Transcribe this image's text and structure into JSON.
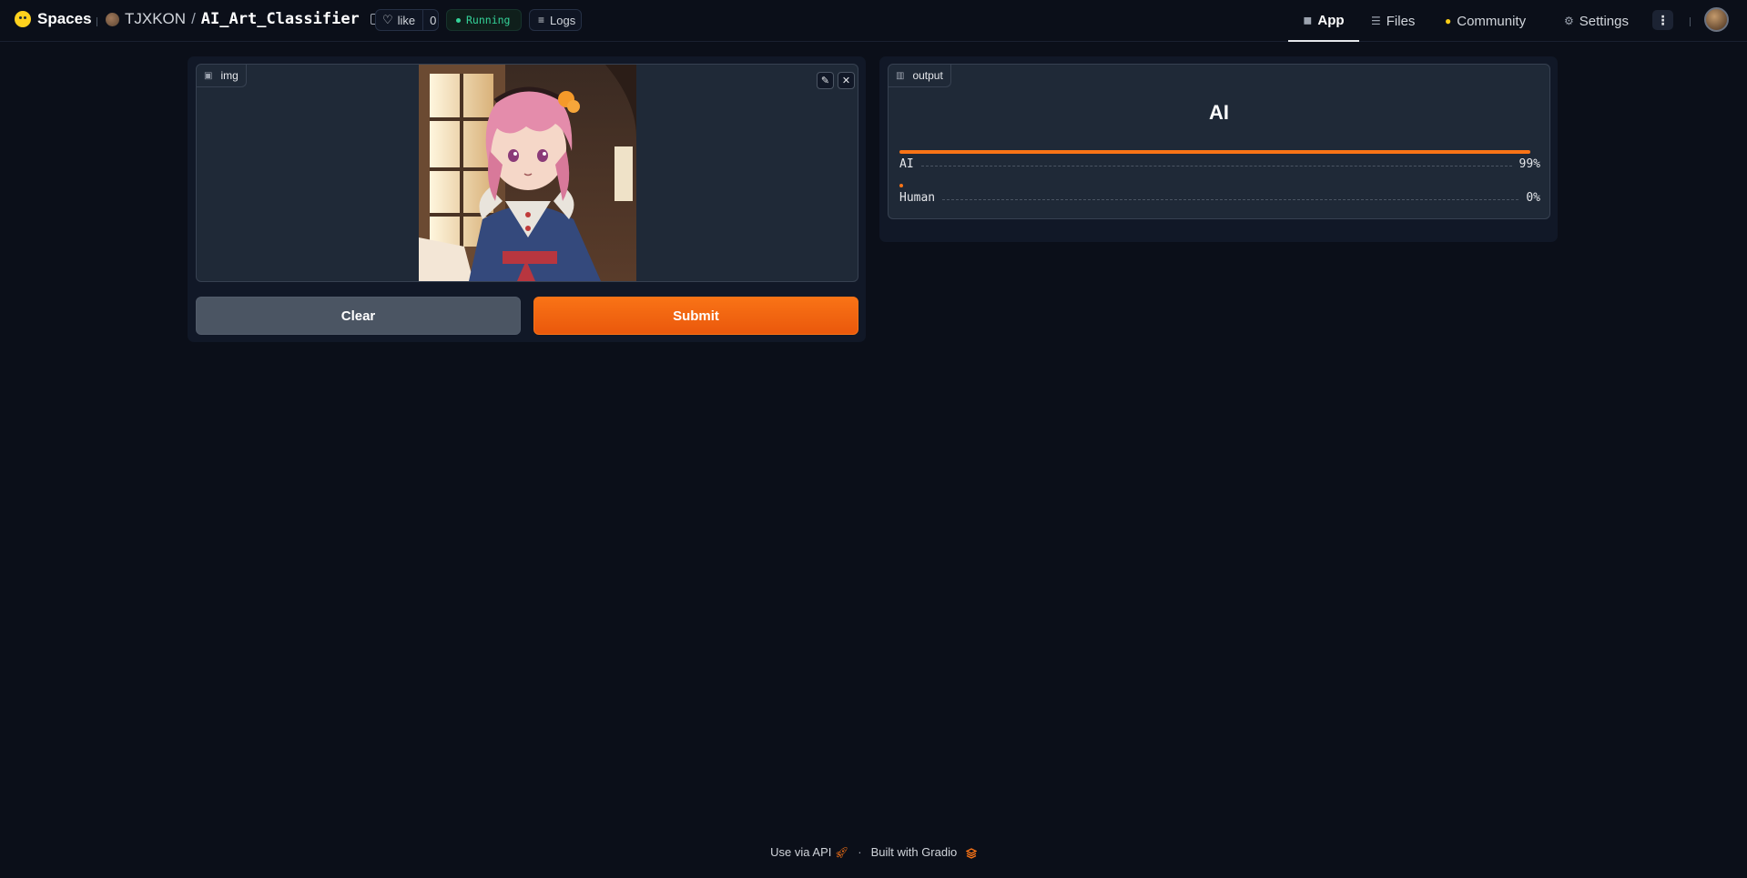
{
  "header": {
    "brand": "Spaces",
    "owner": "TJXKON",
    "repo_name": "AI_Art_Classifier",
    "like_label": "like",
    "like_count": "0",
    "status": "Running",
    "logs_label": "Logs",
    "tabs": [
      {
        "label": "App",
        "icon": "cube-icon",
        "active": true
      },
      {
        "label": "Files",
        "icon": "files-icon",
        "active": false
      },
      {
        "label": "Community",
        "icon": "community-icon",
        "active": false
      },
      {
        "label": "Settings",
        "icon": "gear-icon",
        "active": false
      }
    ]
  },
  "input": {
    "label": "img",
    "clear_label": "Clear",
    "submit_label": "Submit"
  },
  "output": {
    "label": "output",
    "top_label": "AI",
    "confidences": [
      {
        "label": "AI",
        "value_text": "99%",
        "fraction": 0.99
      },
      {
        "label": "Human",
        "value_text": "0%",
        "fraction": 0.005
      }
    ]
  },
  "footer": {
    "api_label": "Use via API",
    "separator": "·",
    "built_with": "Built with Gradio"
  },
  "colors": {
    "accent": "#f97316",
    "background": "#0b0f19",
    "panel": "#111827",
    "running": "#34d399"
  }
}
